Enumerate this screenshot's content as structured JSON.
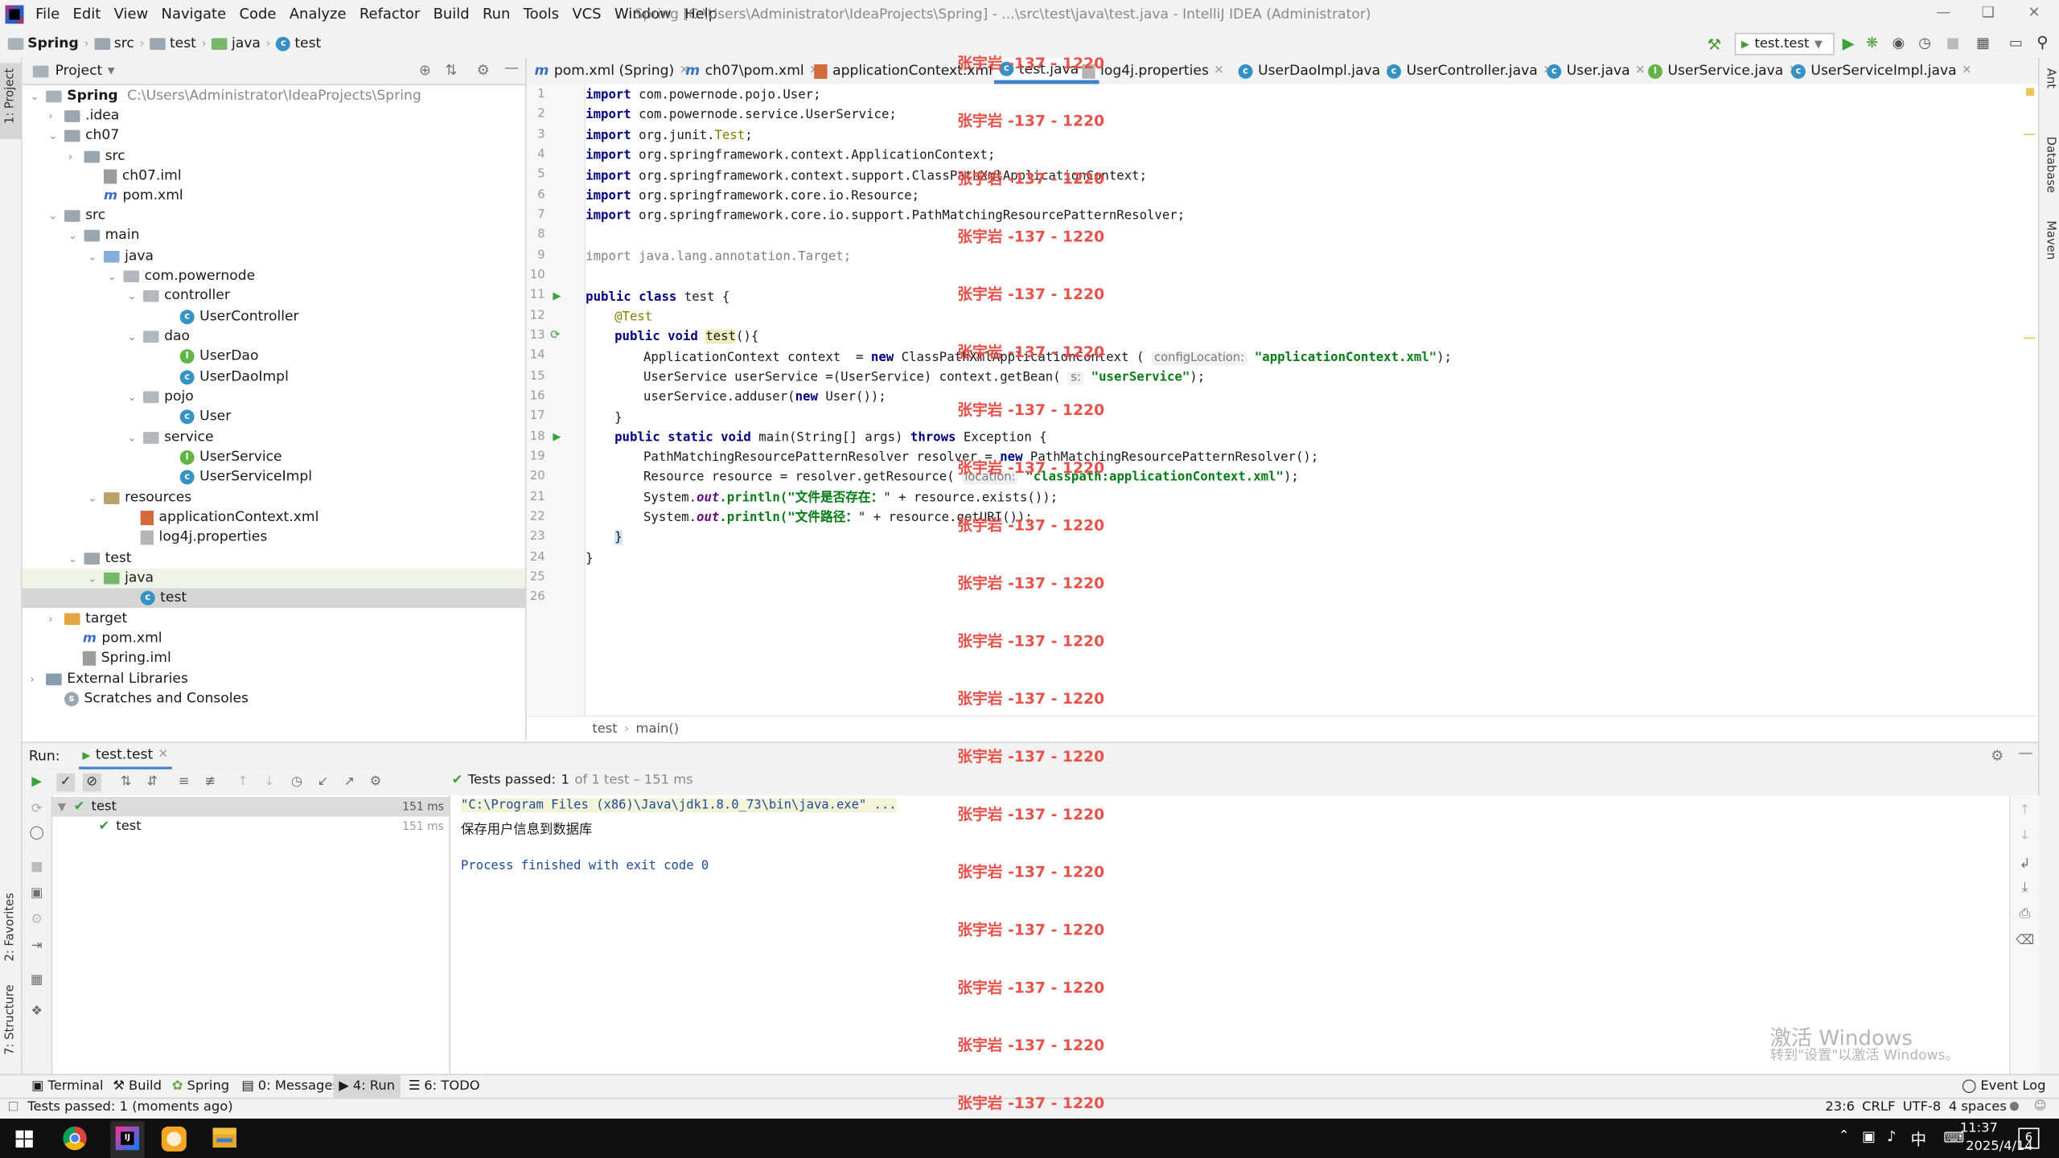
{
  "menubar": {
    "items": [
      "File",
      "Edit",
      "View",
      "Navigate",
      "Code",
      "Analyze",
      "Refactor",
      "Build",
      "Run",
      "Tools",
      "VCS",
      "Window",
      "Help"
    ],
    "window_title": "Spring [C:\\Users\\Administrator\\IdeaProjects\\Spring] - ...\\src\\test\\java\\test.java - IntelliJ IDEA (Administrator)"
  },
  "navbar": {
    "crumbs": [
      "Spring",
      "src",
      "test",
      "java",
      "test"
    ],
    "run_config": "test.test"
  },
  "left_strip": {
    "project": "1: Project",
    "favorites": "2: Favorites",
    "structure": "7: Structure"
  },
  "right_strip": {
    "ant": "Ant",
    "database": "Database",
    "maven": "Maven"
  },
  "project_panel": {
    "title": "Project",
    "tree": [
      {
        "label": "Spring",
        "extra": "C:\\Users\\Administrator\\IdeaProjects\\Spring",
        "icon": "module-folder-icon"
      },
      {
        "label": ".idea",
        "icon": "folder-icon"
      },
      {
        "label": "ch07",
        "icon": "folder-icon"
      },
      {
        "label": "src",
        "icon": "folder-icon"
      },
      {
        "label": "ch07.iml",
        "icon": "iml-file-icon"
      },
      {
        "label": "pom.xml",
        "icon": "maven-file-icon"
      },
      {
        "label": "src",
        "icon": "folder-icon"
      },
      {
        "label": "main",
        "icon": "folder-icon"
      },
      {
        "label": "java",
        "icon": "source-folder-icon"
      },
      {
        "label": "com.powernode",
        "icon": "package-icon"
      },
      {
        "label": "controller",
        "icon": "package-icon"
      },
      {
        "label": "UserController",
        "icon": "class-icon"
      },
      {
        "label": "dao",
        "icon": "package-icon"
      },
      {
        "label": "UserDao",
        "icon": "interface-icon"
      },
      {
        "label": "UserDaoImpl",
        "icon": "class-icon"
      },
      {
        "label": "pojo",
        "icon": "package-icon"
      },
      {
        "label": "User",
        "icon": "class-icon"
      },
      {
        "label": "service",
        "icon": "package-icon"
      },
      {
        "label": "UserService",
        "icon": "interface-icon"
      },
      {
        "label": "UserServiceImpl",
        "icon": "class-icon"
      },
      {
        "label": "resources",
        "icon": "resources-folder-icon"
      },
      {
        "label": "applicationContext.xml",
        "icon": "xml-file-icon"
      },
      {
        "label": "log4j.properties",
        "icon": "properties-file-icon"
      },
      {
        "label": "test",
        "icon": "folder-icon"
      },
      {
        "label": "java",
        "icon": "test-source-folder-icon"
      },
      {
        "label": "test",
        "icon": "test-class-icon"
      },
      {
        "label": "target",
        "icon": "excluded-folder-icon"
      },
      {
        "label": "pom.xml",
        "icon": "maven-file-icon"
      },
      {
        "label": "Spring.iml",
        "icon": "iml-file-icon"
      },
      {
        "label": "External Libraries",
        "icon": "libraries-icon"
      },
      {
        "label": "Scratches and Consoles",
        "icon": "scratches-icon"
      }
    ]
  },
  "editor": {
    "tabs": [
      "pom.xml (Spring)",
      "ch07\\pom.xml",
      "applicationContext.xml",
      "test.java",
      "log4j.properties",
      "UserDaoImpl.java",
      "UserController.java",
      "User.java",
      "UserService.java",
      "UserServiceImpl.java"
    ],
    "active_tab": "test.java",
    "line_numbers": [
      "1",
      "2",
      "3",
      "4",
      "5",
      "6",
      "7",
      "8",
      "9",
      "10",
      "11",
      "12",
      "13",
      "14",
      "15",
      "16",
      "17",
      "18",
      "19",
      "20",
      "21",
      "22",
      "23",
      "24",
      "25",
      "26"
    ],
    "code": {
      "l1": "import com.powernode.pojo.User;",
      "l2": "import com.powernode.service.UserService;",
      "l3a": "import org.junit.",
      "l3b": "Test",
      "l3c": ";",
      "l4": "import org.springframework.context.ApplicationContext;",
      "l5": "import org.springframework.context.support.ClassPathXmlApplicationContext;",
      "l6": "import org.springframework.core.io.Resource;",
      "l7": "import org.springframework.core.io.support.PathMatchingResourcePatternResolver;",
      "l9": "import java.lang.annotation.Target;",
      "l11": "public class test {",
      "l12": "@Test",
      "l13a": "public void ",
      "l13b": "test",
      "l13c": "(){",
      "l14a": "ApplicationContext context  = ",
      "l14b": "new",
      "l14c": " ClassPathXmlApplicationContext ( ",
      "l14hint": "configLocation:",
      "l14str": "\"applicationContext.xml\"",
      "l14d": ");",
      "l15a": "UserService userService =(UserService) context.getBean( ",
      "l15hint": "s:",
      "l15str": "\"userService\"",
      "l15d": ");",
      "l16a": "userService.adduser(",
      "l16b": "new",
      "l16c": " User());",
      "l17": "}",
      "l18a": "public static void ",
      "l18b": "main(String[] args) ",
      "l18c": "throws",
      "l18d": " Exception {",
      "l19a": "PathMatchingResourcePatternResolver resolver = ",
      "l19b": "new",
      "l19c": " PathMatchingResourcePatternResolver();",
      "l20a": "Resource resource = resolver.getResource( ",
      "l20hint": "location:",
      "l20str": "\"classpath:applicationContext.xml\"",
      "l20d": ");",
      "l21a": "System.",
      "l21b": "out",
      "l21c": ".println(\"",
      "l21str": "文件是否存在：",
      "l21d": "\" + resource.exists());",
      "l22a": "System.",
      "l22b": "out",
      "l22c": ".println(\"",
      "l22str": "文件路径：",
      "l22d": "\" + resource.getURI());",
      "l23": "}",
      "l24": "}"
    },
    "breadcrumb": [
      "test",
      "main()"
    ]
  },
  "watermark": "张宇岩 -137 - 1220",
  "run_panel": {
    "label": "Run:",
    "tab": "test.test",
    "status_prefix": "Tests passed:",
    "status_count": "1",
    "status_suffix": "of 1 test – 151 ms",
    "tree": [
      {
        "label": "test",
        "time": "151 ms"
      },
      {
        "label": "test",
        "time": "151 ms"
      }
    ],
    "console": [
      "\"C:\\Program Files (x86)\\Java\\jdk1.8.0_73\\bin\\java.exe\" ...",
      "保存用户信息到数据库",
      "",
      "Process finished with exit code 0"
    ],
    "activate_title": "激活 Windows",
    "activate_sub": "转到\"设置\"以激活 Windows。"
  },
  "tool_windows": [
    "Terminal",
    "Build",
    "Spring",
    "0: Messages",
    "4: Run",
    "6: TODO"
  ],
  "event_log": "Event Log",
  "status_bar": {
    "message": "Tests passed: 1 (moments ago)",
    "position": "23:6",
    "line_sep": "CRLF",
    "encoding": "UTF-8",
    "indent": "4 spaces"
  },
  "taskbar": {
    "ime": "中",
    "time": "11:37",
    "date": "2025/4/14",
    "notifications": "6"
  }
}
